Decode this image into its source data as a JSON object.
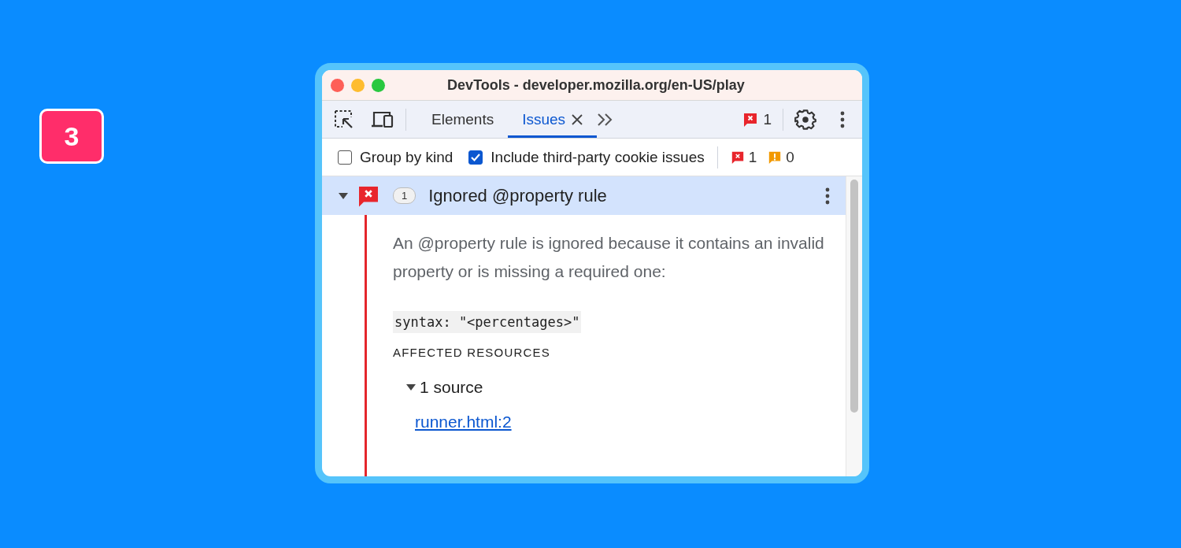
{
  "step_badge": "3",
  "window": {
    "title": "DevTools - developer.mozilla.org/en-US/play"
  },
  "toolbar": {
    "tabs": [
      {
        "label": "Elements",
        "selected": false,
        "closable": false
      },
      {
        "label": "Issues",
        "selected": true,
        "closable": true
      }
    ],
    "error_count": "1"
  },
  "filters": {
    "checkboxes": [
      {
        "label": "Group by kind",
        "checked": false
      },
      {
        "label": "Include third-party cookie issues",
        "checked": true
      }
    ],
    "error_count": "1",
    "warning_count": "0"
  },
  "issue": {
    "expanded": true,
    "count": "1",
    "title": "Ignored @property rule",
    "description": "An @property rule is ignored because it contains an invalid property or is missing a required one:",
    "code": "syntax: \"<percentages>\"",
    "section_heading": "AFFECTED RESOURCES",
    "sources": {
      "label": "1 source",
      "expanded": true,
      "links": [
        "runner.html:2"
      ]
    }
  }
}
